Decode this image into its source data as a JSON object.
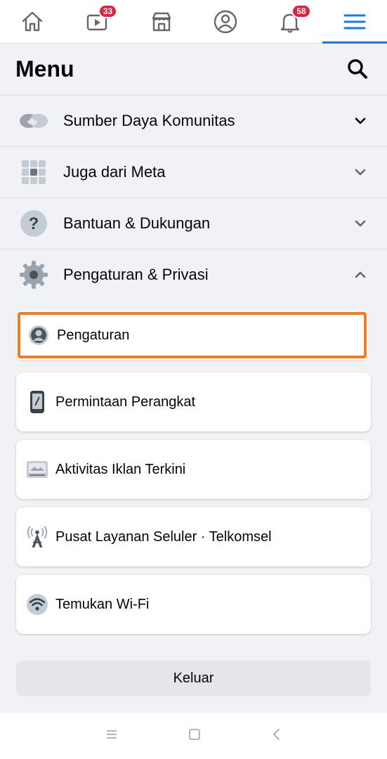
{
  "nav": {
    "items": [
      {
        "name": "home",
        "icon": "home-icon"
      },
      {
        "name": "watch",
        "icon": "video-icon",
        "badge": "33"
      },
      {
        "name": "marketplace",
        "icon": "store-icon"
      },
      {
        "name": "profile",
        "icon": "profile-icon"
      },
      {
        "name": "notifications",
        "icon": "bell-icon",
        "badge": "58"
      },
      {
        "name": "menu",
        "icon": "hamburger-icon",
        "active": true
      }
    ]
  },
  "header": {
    "title": "Menu",
    "search_icon": "search-icon"
  },
  "sections": [
    {
      "label": "Sumber Daya Komunitas",
      "icon": "handshake-icon",
      "expanded": false
    },
    {
      "label": "Juga dari Meta",
      "icon": "grid-icon",
      "expanded": false
    },
    {
      "label": "Bantuan & Dukungan",
      "icon": "help-icon",
      "expanded": false
    },
    {
      "label": "Pengaturan & Privasi",
      "icon": "gear-icon",
      "expanded": true
    }
  ],
  "settings_items": [
    {
      "label": "Pengaturan",
      "icon": "user-icon",
      "highlighted": true
    },
    {
      "label": "Permintaan Perangkat",
      "icon": "phone-icon"
    },
    {
      "label": "Aktivitas Iklan Terkini",
      "icon": "ad-activity-icon"
    },
    {
      "label": "Pusat Layanan Seluler · Telkomsel",
      "icon": "antenna-icon"
    },
    {
      "label": "Temukan Wi-Fi",
      "icon": "wifi-icon"
    }
  ],
  "logout_label": "Keluar",
  "colors": {
    "accent": "#1877f2",
    "badge": "#e41e3f",
    "highlight": "#f47b20",
    "background": "#f0f2f5"
  }
}
